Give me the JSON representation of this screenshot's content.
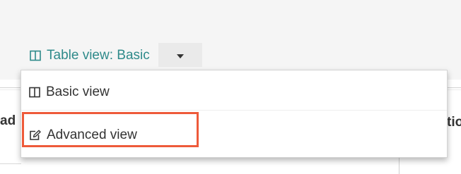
{
  "toolbar": {
    "table_view_label": "Table view: Basic",
    "table_view_icon": "columns-icon",
    "dropdown_icon": "caret-down-icon",
    "accent_color": "#2e8a8a"
  },
  "background_table": {
    "header_left_fragment": "ad",
    "header_right_fragment": "tio"
  },
  "menu": {
    "items": [
      {
        "label": "Basic view",
        "icon": "columns-icon"
      },
      {
        "label": "Advanced view",
        "icon": "edit-icon"
      }
    ],
    "highlight_color": "#ee5a3a"
  }
}
